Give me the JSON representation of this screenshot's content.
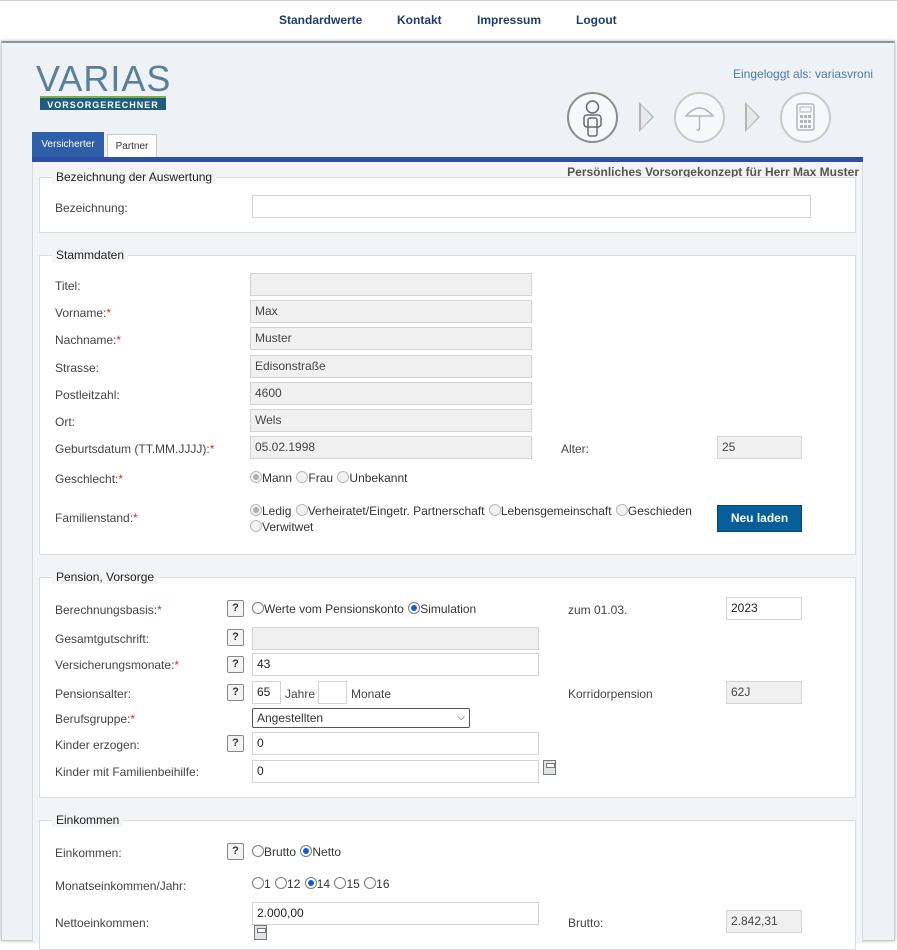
{
  "nav": {
    "items": [
      "Standardwerte",
      "Kontakt",
      "Impressum",
      "Logout"
    ]
  },
  "header": {
    "logo_word": "VARIAS",
    "logo_sub": "VORSORGERECHNER",
    "login_text": "Eingeloggt als: variasvroni"
  },
  "tabs": {
    "active": "Versicherter",
    "inactive": "Partner"
  },
  "konzept_title": "Persönliches Vorsorgekonzept für Herr Max Muster",
  "bezeichnung": {
    "legend": "Bezeichnung der Auswertung",
    "label": "Bezeichnung:",
    "value": ""
  },
  "stammdaten": {
    "legend": "Stammdaten",
    "titel_label": "Titel:",
    "titel_value": "",
    "vorname_label": "Vorname:",
    "vorname_value": "Max",
    "nachname_label": "Nachname:",
    "nachname_value": "Muster",
    "strasse_label": "Strasse:",
    "strasse_value": "Edisonstraße",
    "plz_label": "Postleitzahl:",
    "plz_value": "4600",
    "ort_label": "Ort:",
    "ort_value": "Wels",
    "geburt_label": "Geburtsdatum (TT.MM.JJJJ):",
    "geburt_value": "05.02.1998",
    "alter_label": "Alter:",
    "alter_value": "25",
    "geschlecht_label": "Geschlecht:",
    "geschlecht_options": [
      "Mann",
      "Frau",
      "Unbekannt"
    ],
    "familienstand_label": "Familienstand:",
    "familienstand_options": [
      "Ledig",
      "Verheiratet/Eingetr. Partnerschaft",
      "Lebensgemeinschaft",
      "Geschieden",
      "Verwitwet"
    ],
    "reload_button": "Neu laden",
    "required_mark": "*"
  },
  "pension": {
    "legend": "Pension, Vorsorge",
    "basis_label": "Berechnungsbasis:",
    "basis_options": [
      "Werte vom Pensionskonto",
      "Simulation"
    ],
    "zum_label": "zum 01.03.",
    "zum_value": "2023",
    "gesamt_label": "Gesamtgutschrift:",
    "gesamt_value": "",
    "vmonate_label": "Versicherungsmonate:",
    "vmonate_value": "43",
    "palter_label": "Pensionsalter:",
    "palter_jahre_value": "65",
    "palter_jahre_unit": "Jahre",
    "palter_monate_value": "",
    "palter_monate_unit": "Monate",
    "korridor_label": "Korridorpension",
    "korridor_value": "62J",
    "beruf_label": "Berufsgruppe:",
    "beruf_value": "Angestellten",
    "kinder_label": "Kinder erzogen:",
    "kinder_value": "0",
    "kinderfb_label": "Kinder mit Familienbeihilfe:",
    "kinderfb_value": "0",
    "help_glyph": "?"
  },
  "einkommen": {
    "legend": "Einkommen",
    "ein_label": "Einkommen:",
    "ein_options": [
      "Brutto",
      "Netto"
    ],
    "monat_label": "Monatseinkommen/Jahr:",
    "monat_options": [
      "1",
      "12",
      "14",
      "15",
      "16"
    ],
    "netto_label": "Nettoeinkommen:",
    "netto_value": "2.000,00",
    "brutto_label": "Brutto:",
    "brutto_value": "2.842,31"
  }
}
